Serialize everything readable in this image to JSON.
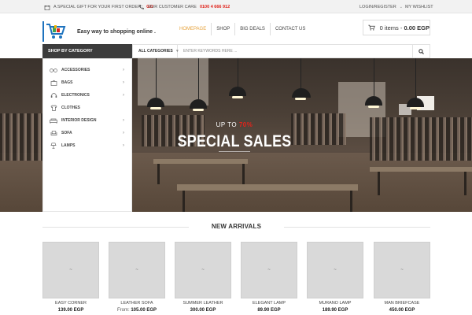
{
  "topbar": {
    "gift_text": "A SPECIAL GIFT FOR YOUR FIRST ORDER :",
    "gift_link": "GO",
    "care_text": "OUR CUSTOMER CARE",
    "care_phone": "0100 4 666 912",
    "login": "LOGIN/REGISTER",
    "wishlist": "MY WISHLIST",
    "icons": {
      "gift": "gift-icon",
      "phone": "phone-icon",
      "caret": "chevron-down-icon"
    }
  },
  "header": {
    "tagline": "Easy way to shopping online .",
    "nav": [
      "HOMEPAGE",
      "SHOP",
      "BIG DEALS",
      "CONTACT US"
    ],
    "cart": {
      "label": "0 items - ",
      "total": "0.00 EGP"
    },
    "icons": {
      "logo": "shopping-cart-logo-icon",
      "cart": "cart-icon"
    }
  },
  "categories": {
    "heading": "SHOP BY CATEGORY",
    "items": [
      {
        "label": "ACCESSORIES",
        "icon": "glasses-icon",
        "has_sub": true
      },
      {
        "label": "BAGS",
        "icon": "bag-icon",
        "has_sub": true
      },
      {
        "label": "ELECTRONICS",
        "icon": "headphones-icon",
        "has_sub": true
      },
      {
        "label": "CLOTHES",
        "icon": "shirt-icon",
        "has_sub": false
      },
      {
        "label": "INTERIOR DESIGN",
        "icon": "sofa-icon",
        "has_sub": true
      },
      {
        "label": "SOFA",
        "icon": "armchair-icon",
        "has_sub": true
      },
      {
        "label": "LAMPS",
        "icon": "lamp-icon",
        "has_sub": true
      }
    ],
    "arrow": "›"
  },
  "search": {
    "category_select": "ALL CATEGORIES",
    "placeholder": "ENTER KEYWORDS HERE ...",
    "button_icon": "search-icon"
  },
  "hero": {
    "up_to": "UP TO",
    "percent": "70%",
    "title": "SPECIAL SALES"
  },
  "new_arrivals": {
    "heading": "NEW ARRIVALS",
    "products": [
      {
        "name": "EASY CORNER",
        "price": "139.00 EGP",
        "prefix": ""
      },
      {
        "name": "LEATHER SOFA",
        "price": "105.00 EGP",
        "prefix": "From:"
      },
      {
        "name": "SUMMER LEATHER",
        "price": "300.00 EGP",
        "prefix": ""
      },
      {
        "name": "ELEGANT LAMP",
        "price": "89.90 EGP",
        "prefix": ""
      },
      {
        "name": "MURANO LAMP",
        "price": "189.90 EGP",
        "prefix": ""
      },
      {
        "name": "MAN BRIEFCASE",
        "price": "450.00 EGP",
        "prefix": ""
      }
    ],
    "placeholder_glyph": "~"
  },
  "colors": {
    "accent": "#e6a23c",
    "red": "#e0231b",
    "dark": "#3c3c3c",
    "brand_blue": "#1e73be"
  }
}
